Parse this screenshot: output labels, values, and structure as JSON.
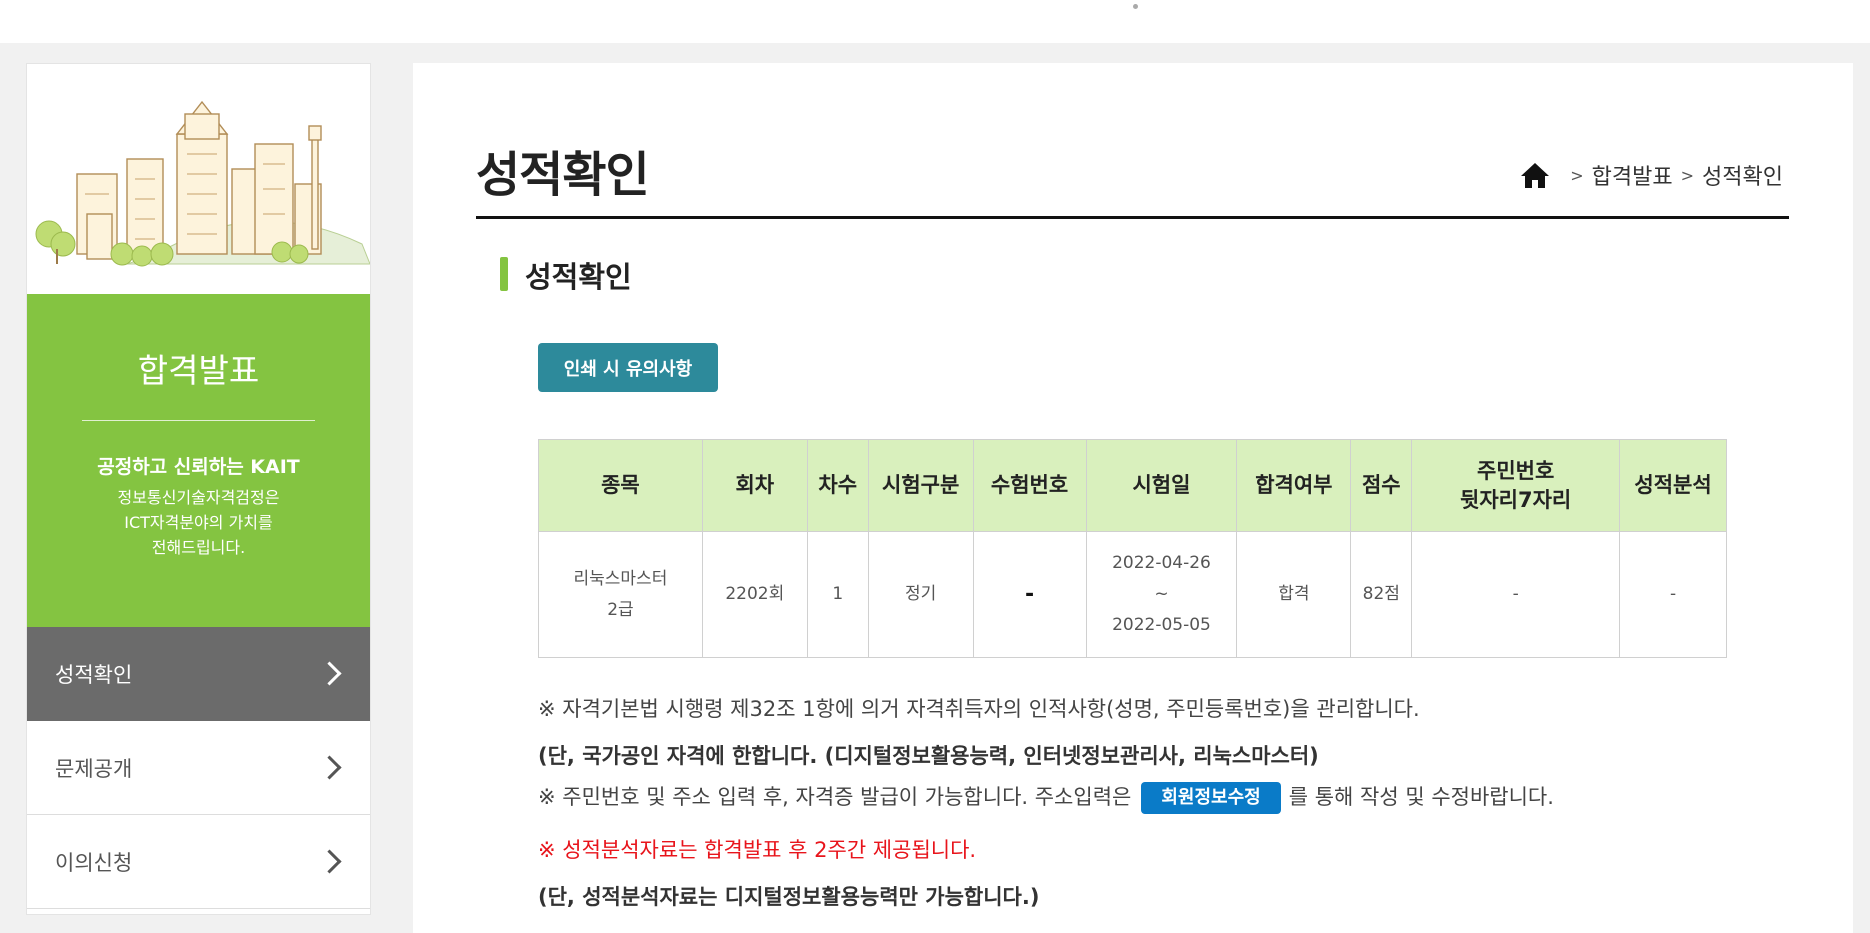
{
  "sidebar": {
    "section_title": "합격발표",
    "slogan": "공정하고 신뢰하는 KAIT",
    "desc_lines": [
      "정보통신기술자격검정은",
      "ICT자격분야의 가치를",
      "전해드립니다."
    ],
    "menu": [
      {
        "label": "성적확인",
        "active": true
      },
      {
        "label": "문제공개",
        "active": false
      },
      {
        "label": "이의신청",
        "active": false
      }
    ]
  },
  "main": {
    "page_title": "성적확인",
    "breadcrumb": {
      "home_icon": "home-icon",
      "sep": ">",
      "items": [
        "합격발표",
        "성적확인"
      ]
    },
    "sub_title": "성적확인",
    "print_button": "인쇄 시 유의사항"
  },
  "table": {
    "headers": [
      "종목",
      "회차",
      "차수",
      "시험구분",
      "수험번호",
      "시험일",
      "합격여부",
      "점수",
      "주민번호",
      "뒷자리7자리",
      "성적분석"
    ],
    "row": {
      "subject": [
        "리눅스마스터",
        "2급"
      ],
      "round": "2202회",
      "session": "1",
      "type": "정기",
      "exam_number": "-",
      "exam_date": [
        "2022-04-26",
        "~",
        "2022-05-05"
      ],
      "result": "합격",
      "score": "82점",
      "resident_number": "-",
      "analysis": "-"
    }
  },
  "notes": {
    "line1": "※ 자격기본법 시행령 제32조 1항에 의거 자격취득자의 인적사항(성명, 주민등록번호)을 관리합니다.",
    "line2": "(단, 국가공인 자격에 한합니다. (디지털정보활용능력, 인터넷정보관리사, 리눅스마스터)",
    "line3_pre": "※ 주민번호 및 주소 입력 후, 자격증 발급이 가능합니다. 주소입력은",
    "line3_button": "회원정보수정",
    "line3_post": "를 통해 작성 및 수정바랍니다.",
    "line4": "※ 성적분석자료는 합격발표 후 2주간 제공됩니다.",
    "line5": "(단, 성적분석자료는 디지털정보활용능력만 가능합니다.)"
  },
  "colors": {
    "brand_green": "#84c441",
    "header_green": "#d9f0bd",
    "teal_button": "#2d8a9b",
    "blue_button": "#0a7bc8",
    "red_note": "#e8141b"
  }
}
